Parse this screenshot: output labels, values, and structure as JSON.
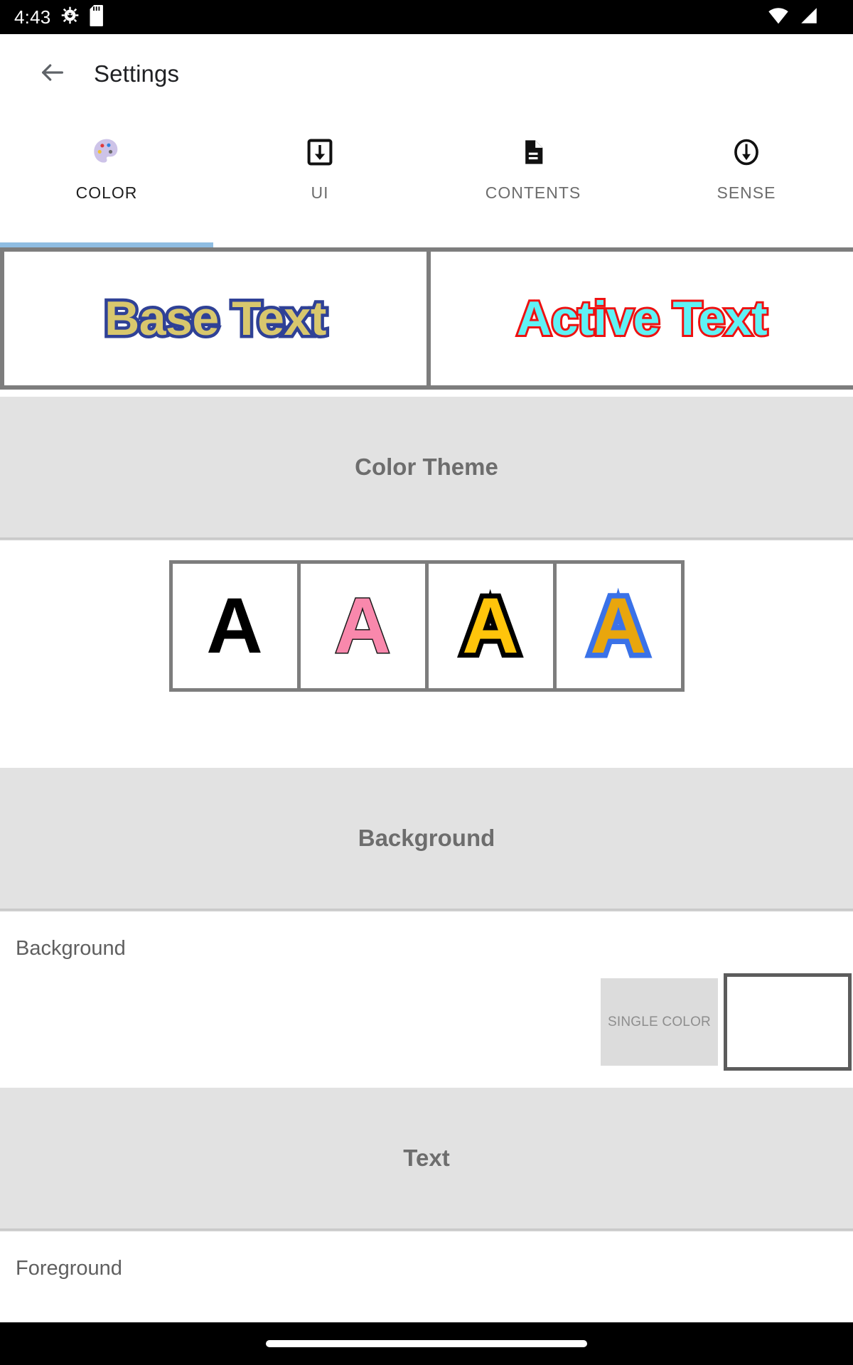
{
  "status_bar": {
    "clock": "4:43",
    "left_icons": [
      "android-debug-icon",
      "sd-card-icon"
    ],
    "right_icons": [
      "wifi-icon",
      "cellular-signal-icon"
    ],
    "background": "#000000"
  },
  "app_bar": {
    "back_icon": "arrow-left-icon",
    "title": "Settings"
  },
  "tabs": {
    "active_index": 0,
    "indicator_color": "#8fbde2",
    "items": [
      {
        "label": "COLOR",
        "icon": "palette-icon",
        "active": true
      },
      {
        "label": "UI",
        "icon": "download-box-icon",
        "active": false
      },
      {
        "label": "CONTENTS",
        "icon": "document-icon",
        "active": false
      },
      {
        "label": "SENSE",
        "icon": "circle-down-arrow-icon",
        "active": false
      }
    ]
  },
  "preview": {
    "frame_color": "#7d7d7d",
    "samples": [
      {
        "text": "Base Text",
        "fill": "#d8c76d",
        "outline": "#2f4196"
      },
      {
        "text": "Active Text",
        "fill": "#5ff2f5",
        "outline": "#ee1111"
      }
    ]
  },
  "sections": {
    "color_theme": {
      "title": "Color Theme",
      "swatches": [
        {
          "glyph": "A",
          "fill": "#000000",
          "outline": "none"
        },
        {
          "glyph": "A",
          "fill": "#f988ac",
          "outline": "#1a1a1a"
        },
        {
          "glyph": "A",
          "fill": "#ffc40b",
          "outline": "#000000"
        },
        {
          "glyph": "A",
          "fill": "#e9a60d",
          "outline": "#3a72e8"
        }
      ]
    },
    "background": {
      "title": "Background",
      "row_label": "Background",
      "mode_chip": "SINGLE COLOR",
      "color_value": "#ffffff"
    },
    "text": {
      "title": "Text",
      "row_label": "Foreground"
    }
  },
  "nav_bar": {
    "gesture_pill": "home-pill"
  }
}
